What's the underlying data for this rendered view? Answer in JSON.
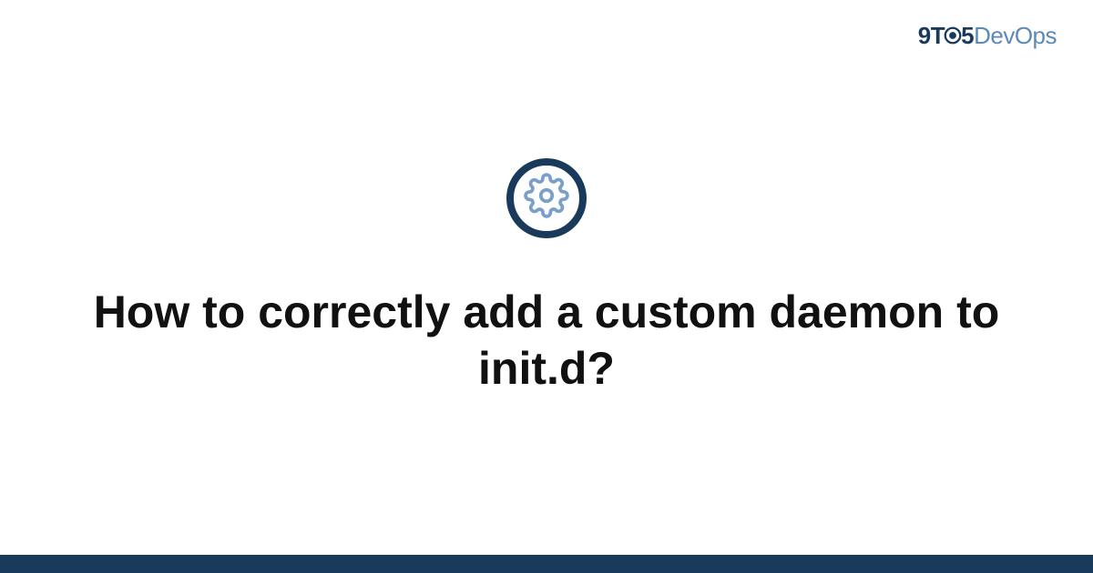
{
  "logo": {
    "part1": "9T",
    "part2": "5",
    "part3": "DevOps"
  },
  "title": "How to correctly add a custom daemon to init.d?",
  "colors": {
    "dark_blue": "#1a3a5c",
    "light_blue": "#5b89b8",
    "gear_stroke": "#7a9fc9"
  }
}
